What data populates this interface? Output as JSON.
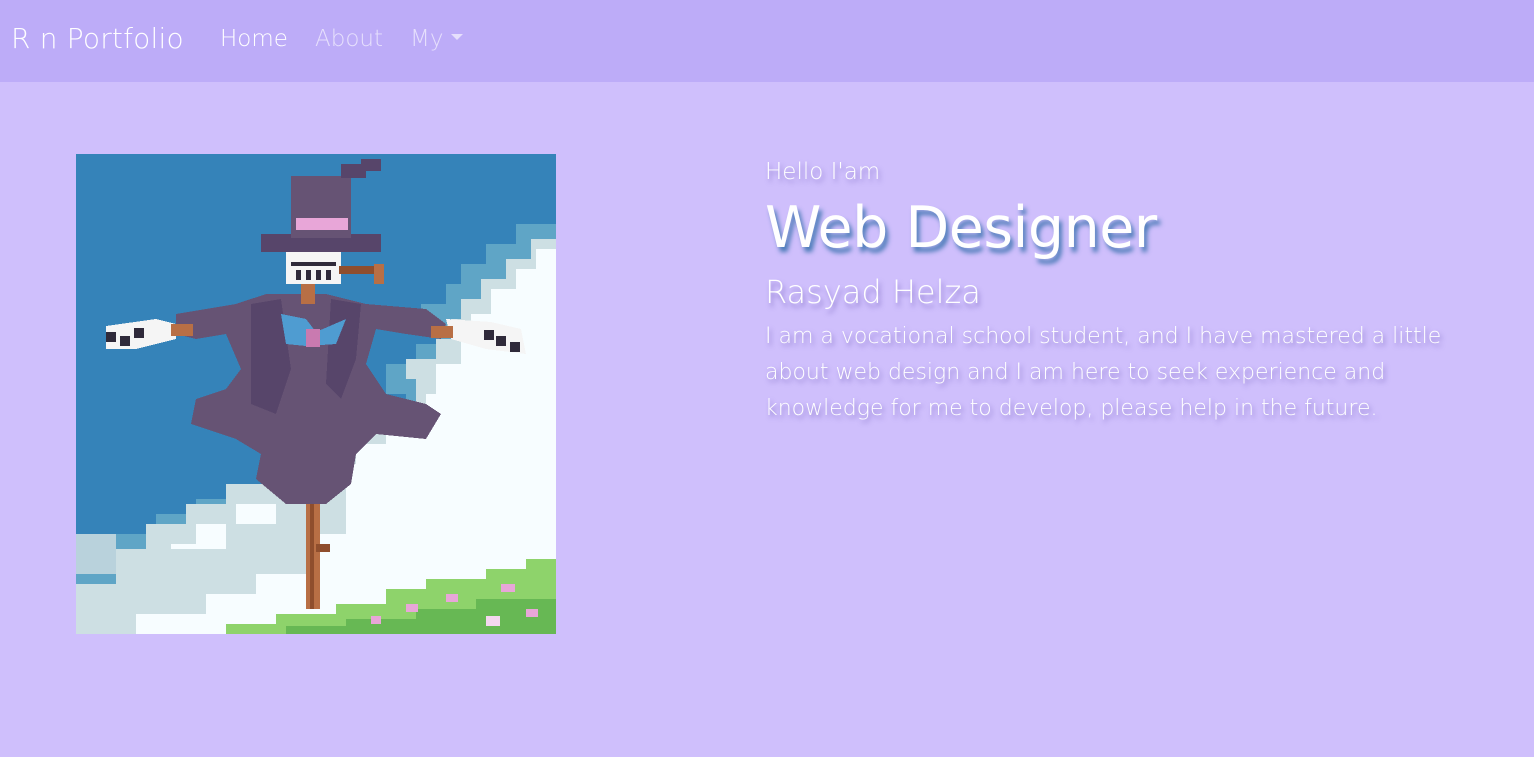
{
  "navbar": {
    "brand": "R n Portfolio",
    "links": [
      {
        "label": "Home",
        "active": true
      },
      {
        "label": "About",
        "active": false
      },
      {
        "label": "My",
        "dropdown": true
      }
    ],
    "background": "#bdacf8"
  },
  "hero": {
    "image_alt": "Pixel-art scarecrow with top hat in front of sky and clouds",
    "greeting": "Hello I'am",
    "role": "Web Designer",
    "name": "Rasyad Helza",
    "bio": "I am a vocational school student, and I have mastered a little about web design and I am here to seek experience and knowledge for me to develop, please help in the future."
  },
  "colors": {
    "page_background": "#cfbffc",
    "text": "#ffffff",
    "sky": "#3583b9",
    "cloud": "#f7fdff"
  }
}
